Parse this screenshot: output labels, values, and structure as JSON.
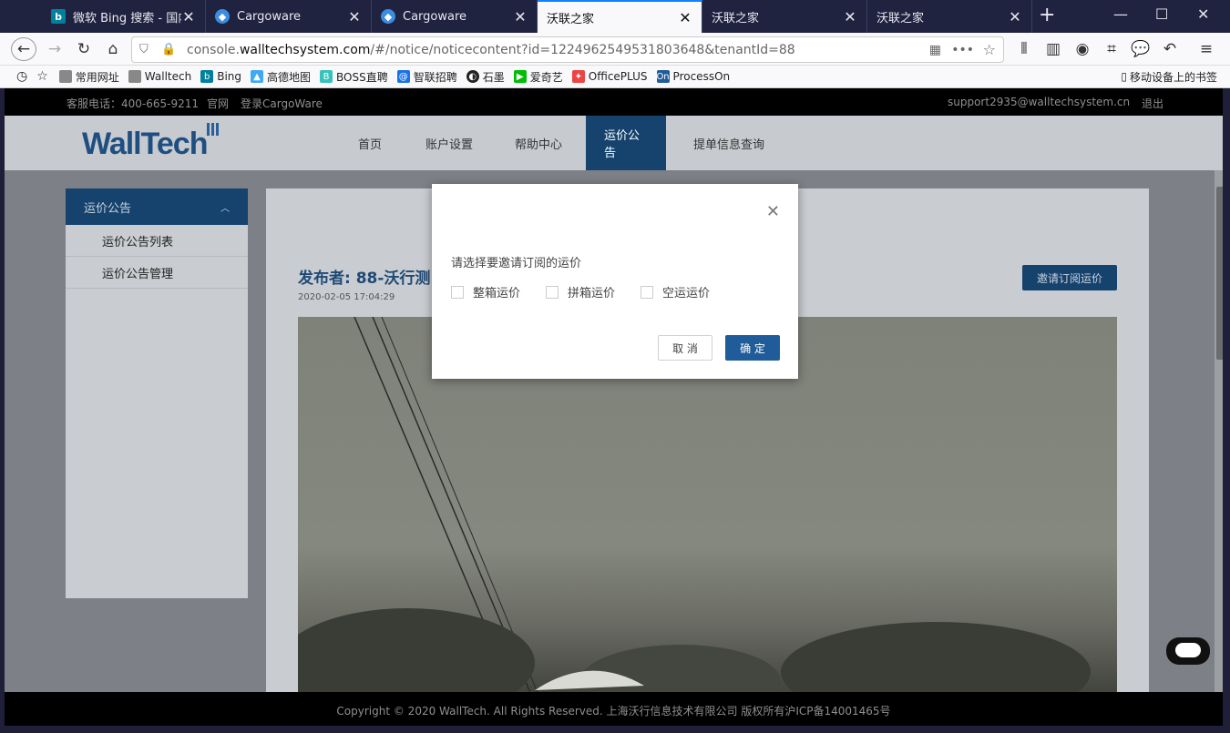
{
  "browser": {
    "tabs": [
      {
        "title": "微软 Bing 搜索 - 国内版",
        "favicon": "bing-icon"
      },
      {
        "title": "Cargoware",
        "favicon": "cargoware-icon"
      },
      {
        "title": "Cargoware",
        "favicon": "cargoware-icon"
      },
      {
        "title": "沃联之家",
        "favicon": "none"
      },
      {
        "title": "沃联之家",
        "favicon": "none"
      },
      {
        "title": "沃联之家",
        "favicon": "none"
      }
    ],
    "active_tab_index": 3,
    "url_prefix": "console.",
    "url_domain": "walltechsystem.com",
    "url_rest": "/#/notice/noticecontent?id=1224962549531803648&tenantId=88",
    "bookmarks": [
      {
        "label": "常用网址",
        "icon": "folder-icon"
      },
      {
        "label": "Walltech",
        "icon": "folder-icon"
      },
      {
        "label": "Bing",
        "icon": "bing-icon"
      },
      {
        "label": "高德地图",
        "icon": "amap-icon"
      },
      {
        "label": "BOSS直聘",
        "icon": "boss-icon"
      },
      {
        "label": "智联招聘",
        "icon": "zhaopin-icon"
      },
      {
        "label": "石墨",
        "icon": "shimo-icon"
      },
      {
        "label": "爱奇艺",
        "icon": "iqiyi-icon"
      },
      {
        "label": "OfficePLUS",
        "icon": "officeplus-icon"
      },
      {
        "label": "ProcessOn",
        "icon": "processon-icon"
      }
    ],
    "mobile_bookmarks": "移动设备上的书签"
  },
  "site": {
    "topbar": {
      "phone": "客服电话：400-665-9211",
      "official_site": "官网",
      "login": "登录CargoWare",
      "email": "support2935@walltechsystem.cn",
      "logout": "退出"
    },
    "logo": "WallTech",
    "menu": [
      "首页",
      "账户设置",
      "帮助中心",
      "运价公告",
      "提单信息查询"
    ],
    "active_menu": "运价公告",
    "sidebar": {
      "header": "运价公告",
      "items": [
        "运价公告列表",
        "运价公告管理"
      ]
    },
    "notice": {
      "publisher": "发布者:   88-沃行测",
      "date": "2020-02-05 17:04:29",
      "invite_button": "邀请订阅运价"
    },
    "footer": "Copyright © 2020 WallTech. All Rights Reserved. 上海沃行信息技术有限公司 版权所有沪ICP备14001465号"
  },
  "dialog": {
    "prompt": "请选择要邀请订阅的运价",
    "options": [
      "整箱运价",
      "拼箱运价",
      "空运运价"
    ],
    "cancel": "取 消",
    "confirm": "确 定"
  }
}
